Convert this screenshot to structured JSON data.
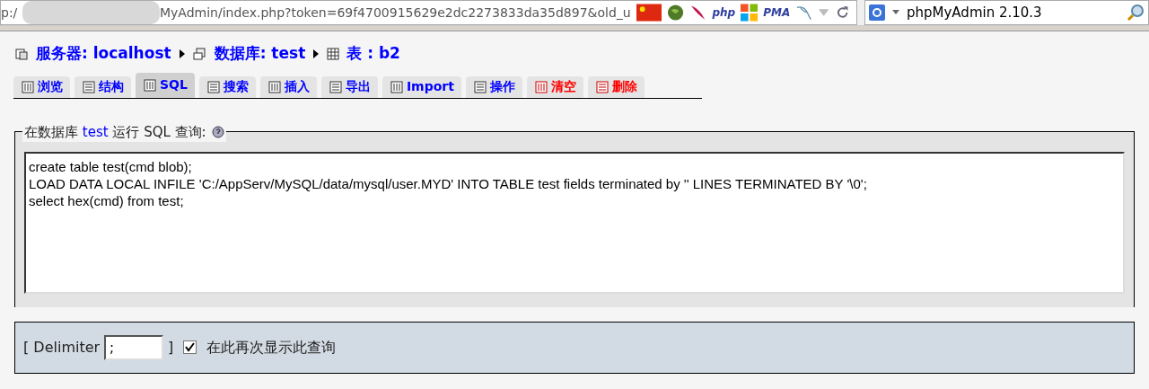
{
  "browser": {
    "url_start": "p:/",
    "url_rest": "MyAdmin/index.php?token=69f4700915629e2dc2273833da35d897&old_u",
    "addons": [
      {
        "kind": "flag"
      },
      {
        "kind": "globe"
      },
      {
        "kind": "feather"
      },
      {
        "kind": "text",
        "label": "php"
      },
      {
        "kind": "windows"
      },
      {
        "kind": "text",
        "label": "PMA"
      },
      {
        "kind": "dolphin"
      }
    ],
    "search_value": "phpMyAdmin 2.10.3"
  },
  "breadcrumb": [
    {
      "kind": "server",
      "label": "服务器: localhost"
    },
    {
      "kind": "database",
      "label": "数据库: test"
    },
    {
      "kind": "table",
      "label": "表 : b2"
    }
  ],
  "tabs": [
    {
      "label": "浏览",
      "selected": false,
      "danger": false
    },
    {
      "label": "结构",
      "selected": false,
      "danger": false
    },
    {
      "label": "SQL",
      "selected": true,
      "danger": false
    },
    {
      "label": "搜索",
      "selected": false,
      "danger": false
    },
    {
      "label": "插入",
      "selected": false,
      "danger": false
    },
    {
      "label": "导出",
      "selected": false,
      "danger": false
    },
    {
      "label": "Import",
      "selected": false,
      "danger": false
    },
    {
      "label": "操作",
      "selected": false,
      "danger": false
    },
    {
      "label": "清空",
      "selected": false,
      "danger": true
    },
    {
      "label": "删除",
      "selected": false,
      "danger": true
    }
  ],
  "query_panel": {
    "legend_before": "在数据库",
    "legend_db": "test",
    "legend_after": "运行 SQL 查询:",
    "sql_lines": [
      "create table test(cmd blob);",
      "LOAD DATA LOCAL INFILE 'C:/AppServ/MySQL/data/mysql/user.MYD' INTO TABLE test fields terminated by '' LINES TERMINATED BY '\\0';",
      "select hex(cmd) from test;"
    ],
    "delimiter_open": "[ Delimiter",
    "delimiter_value": ";",
    "delimiter_close": "]",
    "show_again": {
      "label": "在此再次显示此查询",
      "checked": true
    }
  }
}
